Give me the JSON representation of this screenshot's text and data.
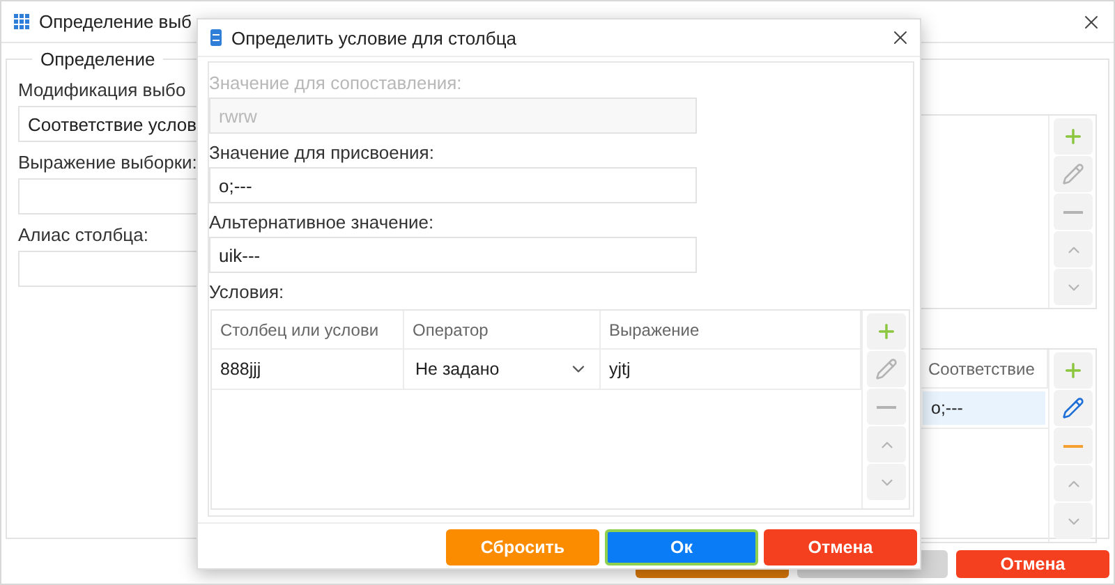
{
  "main_window": {
    "title": "Определение выб",
    "legend": "Определение",
    "fields": [
      {
        "label": "Модификация выбо",
        "value": "Соответствие услов"
      },
      {
        "label": "Выражение выборки:"
      },
      {
        "label": "Алиас столбца:"
      }
    ],
    "top_list": {
      "tools": [
        {
          "kind": "add",
          "disabled": false
        },
        {
          "kind": "edit",
          "disabled": true
        },
        {
          "kind": "remove",
          "disabled": true
        },
        {
          "kind": "up",
          "disabled": true
        },
        {
          "kind": "down",
          "disabled": true
        }
      ]
    },
    "bottom_list": {
      "columns": [
        "Соответствие"
      ],
      "rows": [
        {
          "cells": [
            "o;---"
          ],
          "selected": true
        }
      ],
      "tools": [
        {
          "kind": "add",
          "disabled": false
        },
        {
          "kind": "edit",
          "disabled": false
        },
        {
          "kind": "remove",
          "disabled": false
        },
        {
          "kind": "up",
          "disabled": true
        },
        {
          "kind": "down",
          "disabled": true
        }
      ]
    },
    "buttons": [
      {
        "kind": "reset"
      },
      {
        "kind": "ok"
      },
      {
        "kind": "cancel",
        "label": "Отмена"
      }
    ]
  },
  "dialog": {
    "title": "Определить условие для столбца",
    "fields": [
      {
        "label": "Значение для сопоставления:",
        "value": "rwrw",
        "disabled": true
      },
      {
        "label": "Значение для присвоения:",
        "value": "o;---",
        "disabled": false
      },
      {
        "label": "Альтернативное значение:",
        "value": "uik---",
        "disabled": false
      }
    ],
    "conditions_label": "Условия:",
    "columns": [
      "Столбец или услови",
      "Оператор",
      "Выражение"
    ],
    "rows": [
      {
        "column": "888jjj",
        "operator": "Не задано",
        "expression": "yjtj"
      }
    ],
    "tools": [
      {
        "kind": "add",
        "disabled": false
      },
      {
        "kind": "edit",
        "disabled": true
      },
      {
        "kind": "remove",
        "disabled": true
      },
      {
        "kind": "up",
        "disabled": true
      },
      {
        "kind": "down",
        "disabled": true
      }
    ],
    "buttons": [
      {
        "kind": "reset",
        "label": "Сбросить",
        "focused": false
      },
      {
        "kind": "ok",
        "label": "Ок",
        "focused": true
      },
      {
        "kind": "cancel",
        "label": "Отмена",
        "focused": false
      }
    ]
  }
}
